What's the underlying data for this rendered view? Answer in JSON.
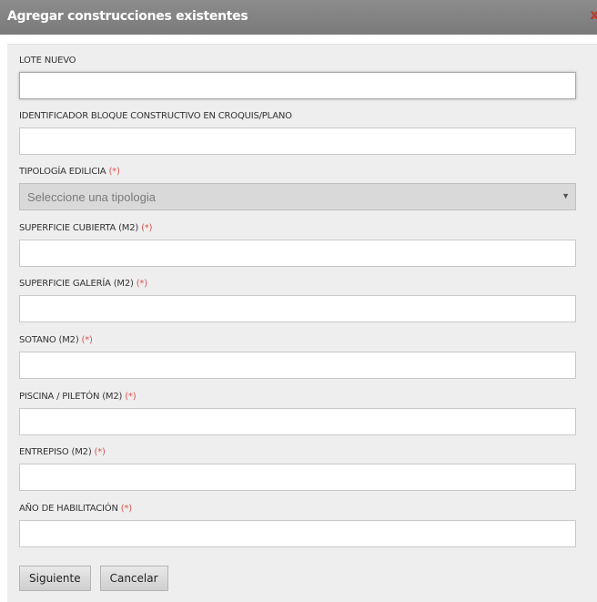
{
  "dialog": {
    "title": "Agregar construcciones existentes",
    "close_label": "x"
  },
  "required_marker": "(*)",
  "fields": {
    "lote_nuevo": {
      "label": "LOTE NUEVO",
      "value": ""
    },
    "identificador": {
      "label": "IDENTIFICADOR BLOQUE CONSTRUCTIVO EN CROQUIS/PLANO",
      "value": ""
    },
    "tipologia": {
      "label": "TIPOLOGÍA EDILICIA",
      "selected": "Seleccione una tipologia"
    },
    "superficie_cubierta": {
      "label": "SUPERFICIE CUBIERTA (M2)",
      "value": ""
    },
    "superficie_galeria": {
      "label": "SUPERFICIE GALERÍA (M2)",
      "value": ""
    },
    "sotano": {
      "label": "SOTANO (M2)",
      "value": ""
    },
    "piscina": {
      "label": "PISCINA / PILETÓN (M2)",
      "value": ""
    },
    "entrepiso": {
      "label": "ENTREPISO (M2)",
      "value": ""
    },
    "anio_habilitacion": {
      "label": "AÑO DE HABILITACIÓN",
      "value": ""
    }
  },
  "buttons": {
    "next_label": "Siguiente",
    "cancel_label": "Cancelar"
  }
}
